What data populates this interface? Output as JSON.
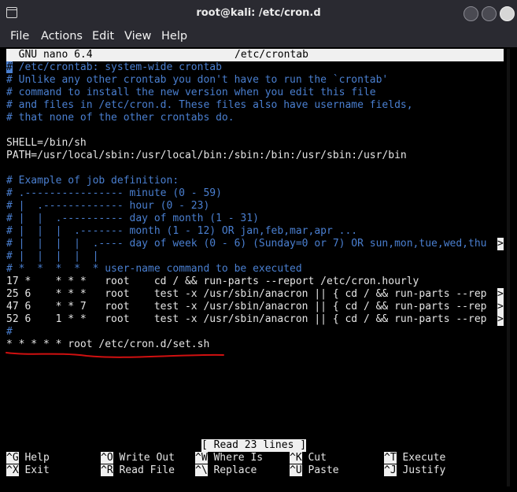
{
  "window": {
    "title": "root@kali: /etc/cron.d"
  },
  "menu": [
    "File",
    "Actions",
    "Edit",
    "View",
    "Help"
  ],
  "nano": {
    "version": "  GNU nano 6.4",
    "filename": "/etc/crontab"
  },
  "lines": [
    {
      "c": "/etc/crontab: system-wide crontab",
      "cursor": true
    },
    {
      "c": "# Unlike any other crontab you don't have to run the `crontab'"
    },
    {
      "c": "# command to install the new version when you edit this file"
    },
    {
      "c": "# and files in /etc/cron.d. These files also have username fields,"
    },
    {
      "c": "# that none of the other crontabs do."
    },
    {
      "c": ""
    },
    {
      "t": "SHELL=/bin/sh"
    },
    {
      "t": "PATH=/usr/local/sbin:/usr/local/bin:/sbin:/bin:/usr/sbin:/usr/bin"
    },
    {
      "c": ""
    },
    {
      "c": "# Example of job definition:"
    },
    {
      "c": "# .---------------- minute (0 - 59)"
    },
    {
      "c": "# |  .------------- hour (0 - 23)"
    },
    {
      "c": "# |  |  .---------- day of month (1 - 31)"
    },
    {
      "c": "# |  |  |  .------- month (1 - 12) OR jan,feb,mar,apr ..."
    },
    {
      "c": "# |  |  |  |  .---- day of week (0 - 6) (Sunday=0 or 7) OR sun,mon,tue,wed,thu",
      "more": ">"
    },
    {
      "c": "# |  |  |  |  |"
    },
    {
      "c": "# *  *  *  *  * user-name command to be executed"
    },
    {
      "t": "17 *    * * *   root    cd / && run-parts --report /etc/cron.hourly"
    },
    {
      "t": "25 6    * * *   root    test -x /usr/sbin/anacron || { cd / && run-parts --rep",
      "more": ">"
    },
    {
      "t": "47 6    * * 7   root    test -x /usr/sbin/anacron || { cd / && run-parts --rep",
      "more": ">"
    },
    {
      "t": "52 6    1 * *   root    test -x /usr/sbin/anacron || { cd / && run-parts --rep",
      "more": ">"
    },
    {
      "c": "#"
    },
    {
      "t": "* * * * * root /etc/cron.d/set.sh"
    }
  ],
  "status_message": "[ Read 23 lines ]",
  "shortcuts": [
    {
      "key": "^G",
      "label": "Help"
    },
    {
      "key": "^X",
      "label": "Exit"
    },
    {
      "key": "^O",
      "label": "Write Out"
    },
    {
      "key": "^R",
      "label": "Read File"
    },
    {
      "key": "^W",
      "label": "Where Is"
    },
    {
      "key": "^\\",
      "label": "Replace"
    },
    {
      "key": "^K",
      "label": "Cut"
    },
    {
      "key": "^U",
      "label": "Paste"
    },
    {
      "key": "^T",
      "label": "Execute"
    },
    {
      "key": "^J",
      "label": "Justify"
    }
  ],
  "colors": {
    "comment": "#4a7fd0",
    "text": "#e6e6e6",
    "annotation": "#d01010",
    "background": "#000000"
  }
}
